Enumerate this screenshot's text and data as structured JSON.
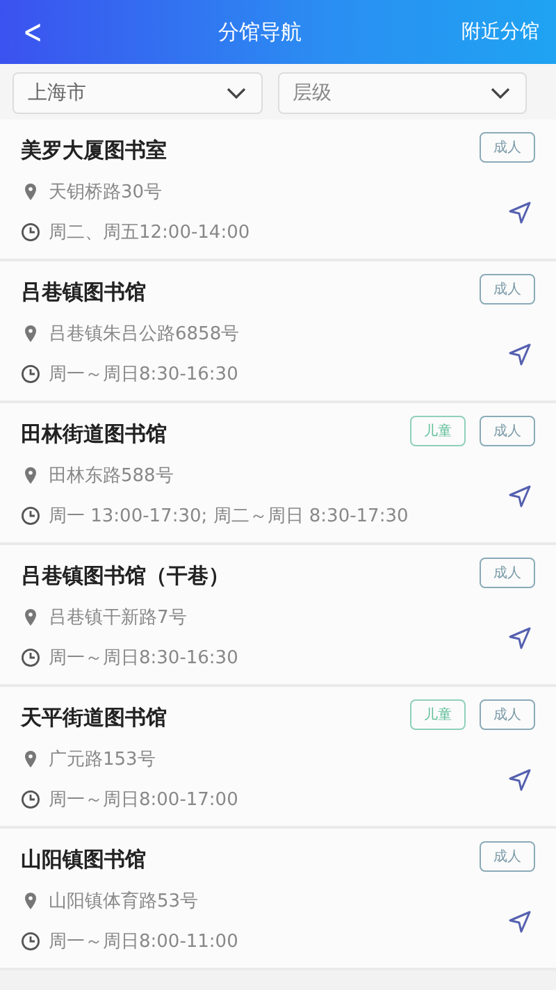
{
  "header": {
    "back": "<",
    "title": "分馆导航",
    "action": "附近分馆"
  },
  "filters": [
    {
      "value": "上海市",
      "kind": "value"
    },
    {
      "value": "层级",
      "kind": "hint"
    }
  ],
  "libraries": [
    {
      "name": "美罗大厦图书室",
      "address": "天钥桥路30号",
      "hours": "周二、周五12:00-14:00",
      "tags": [
        {
          "label": "成人",
          "kind": "adult"
        }
      ]
    },
    {
      "name": "吕巷镇图书馆",
      "address": "吕巷镇朱吕公路6858号",
      "hours": "周一～周日8:30-16:30",
      "tags": [
        {
          "label": "成人",
          "kind": "adult"
        }
      ]
    },
    {
      "name": "田林街道图书馆",
      "address": "田林东路588号",
      "hours": "周一 13:00-17:30; 周二～周日 8:30-17:30",
      "tags": [
        {
          "label": "儿童",
          "kind": "child"
        },
        {
          "label": "成人",
          "kind": "adult"
        }
      ]
    },
    {
      "name": "吕巷镇图书馆（干巷）",
      "address": "吕巷镇干新路7号",
      "hours": "周一～周日8:30-16:30",
      "tags": [
        {
          "label": "成人",
          "kind": "adult"
        }
      ]
    },
    {
      "name": "天平街道图书馆",
      "address": "广元路153号",
      "hours": "周一～周日8:00-17:00",
      "tags": [
        {
          "label": "儿童",
          "kind": "child"
        },
        {
          "label": "成人",
          "kind": "adult"
        }
      ]
    },
    {
      "name": "山阳镇图书馆",
      "address": "山阳镇体育路53号",
      "hours": "周一～周日8:00-11:00",
      "tags": [
        {
          "label": "成人",
          "kind": "adult"
        }
      ]
    }
  ]
}
